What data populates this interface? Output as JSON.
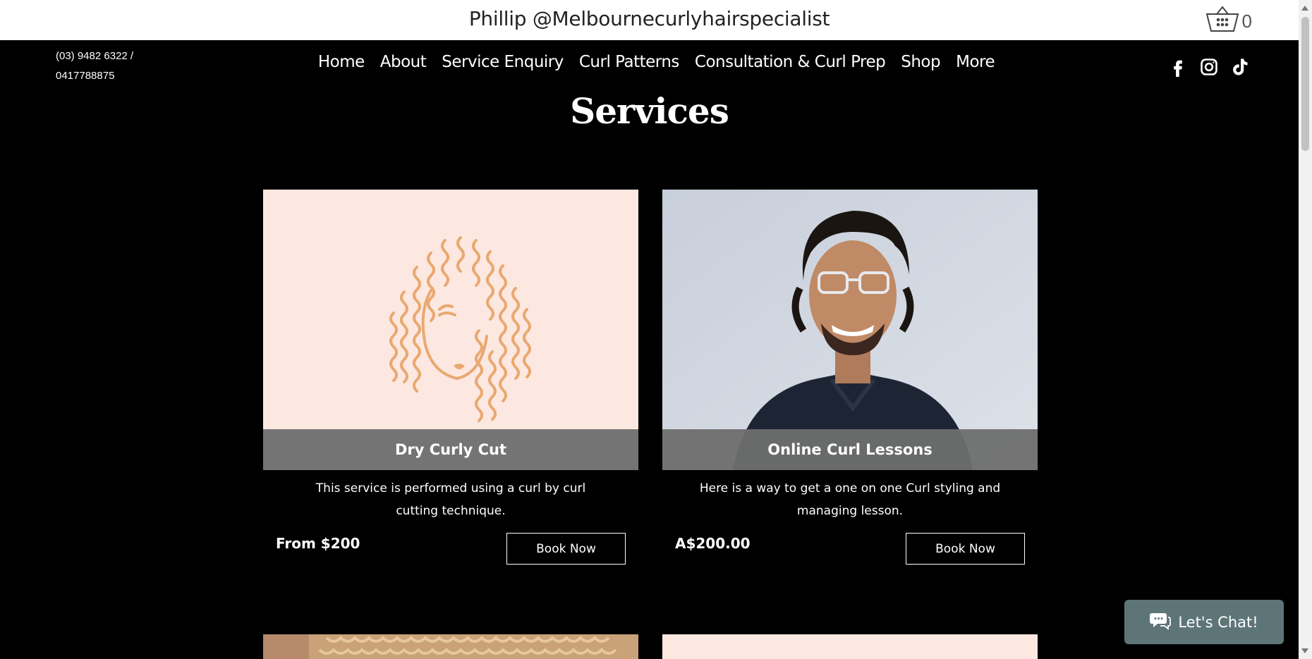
{
  "header": {
    "site_title": "Phillip @Melbournecurlyhairspecialist",
    "cart_count": "0",
    "cart_icon": "cart-icon"
  },
  "contact": {
    "phone_line1": "(03) 9482 6322 /",
    "phone_line2": "0417788875"
  },
  "nav": {
    "items": [
      {
        "label": "Home"
      },
      {
        "label": "About"
      },
      {
        "label": "Service Enquiry"
      },
      {
        "label": "Curl Patterns"
      },
      {
        "label": "Consultation & Curl Prep"
      },
      {
        "label": "Shop"
      },
      {
        "label": "More"
      }
    ]
  },
  "social": {
    "icons": [
      "facebook-icon",
      "instagram-icon",
      "tiktok-icon"
    ]
  },
  "page": {
    "title": "Services"
  },
  "services": [
    {
      "name": "Dry Curly Cut",
      "description": "This service is performed using a curl by curl cutting technique.",
      "price": "From $200",
      "button_label": "Book Now"
    },
    {
      "name": "Online Curl Lessons",
      "description": "Here is a way to get a one on one Curl styling and managing lesson.",
      "price": "A$200.00",
      "button_label": "Book Now"
    }
  ],
  "chat": {
    "label": "Let's Chat!",
    "icon": "chat-bubble-icon"
  },
  "colors": {
    "background": "#000000",
    "header_bg": "#ffffff",
    "card_label_bg": "#6e6e6e",
    "curl_illustration": "#e9a971",
    "illustration_bg": "#fde8e1",
    "chat_bg": "#5e7578"
  }
}
